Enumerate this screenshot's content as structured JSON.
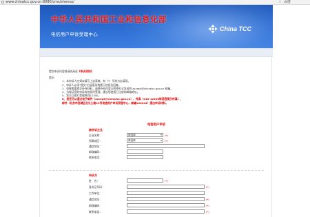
{
  "browser": {
    "url": "www.chinatcc.gov.cn:8080/cms/shensu/",
    "star_icon": "star-icon",
    "extension_text": "百度"
  },
  "banner": {
    "ministry": "中华人民共和国工业和信息化部",
    "center_name": "电信用户申诉受理中心",
    "brand": "China TCC",
    "logo_icon": "tcc-logo-icon"
  },
  "intro": {
    "title_prefix": "提交申诉内容前请先阅读",
    "title_link": "《申诉须知》",
    "notes_head": "提示：",
    "notes": [
      "1、本申诉人应如实填写上述表格，有（*）号的为必填项。",
      "2、申诉人必须\"提交\"后留意系统提示信息及回复。",
      "3、如果需要提交补充材料，请将补充内容以附件形式发送到 accept@chinatcc.gov.cn 邮箱。",
      "4、为保证您的申诉有效及时受理，建议您使用已注册的邮箱地址。",
      "5、您可以拨打受理热线12300。",
      "6、您还可以通过电子邮件（accept@chinatcc.gov.cn）、传真（010-12300转语音提示传真）、",
      "   邮件（北京市西城区北礼士路13号电信用户申诉受理中心，邮编100044）提出申诉材料。"
    ],
    "red_note_indices": [
      5,
      6
    ]
  },
  "form": {
    "section_title": "电信用户申诉",
    "respondent": {
      "legend": "被申诉企业",
      "fields": [
        {
          "label": "企业名称：",
          "value": "请选择",
          "required": "(*)"
        },
        {
          "label": "所属地区：",
          "value": "请选择",
          "required": "(*)"
        },
        {
          "label": "通信地址：",
          "value": "",
          "required": ""
        },
        {
          "label": "邮政编码：",
          "value": "",
          "required": ""
        },
        {
          "label": "联系电话：",
          "value": "",
          "required": ""
        }
      ]
    },
    "complainant": {
      "legend": "申诉方",
      "fields": [
        {
          "label": "姓　名：",
          "value": "",
          "required": "(*)"
        },
        {
          "label": "身份证号码：",
          "value": "",
          "required": "(*)"
        },
        {
          "label": "工作单位：",
          "value": "",
          "required": ""
        },
        {
          "label": "通信地址：",
          "value": "",
          "required": "(*)"
        },
        {
          "label": "邮政编码：",
          "value": "",
          "required": "(*)"
        },
        {
          "label": "联系电话：",
          "value": "",
          "required": "(*)"
        }
      ]
    }
  },
  "colors": {
    "banner_blue": "#2a6ad0",
    "accent_red": "#e00000"
  }
}
